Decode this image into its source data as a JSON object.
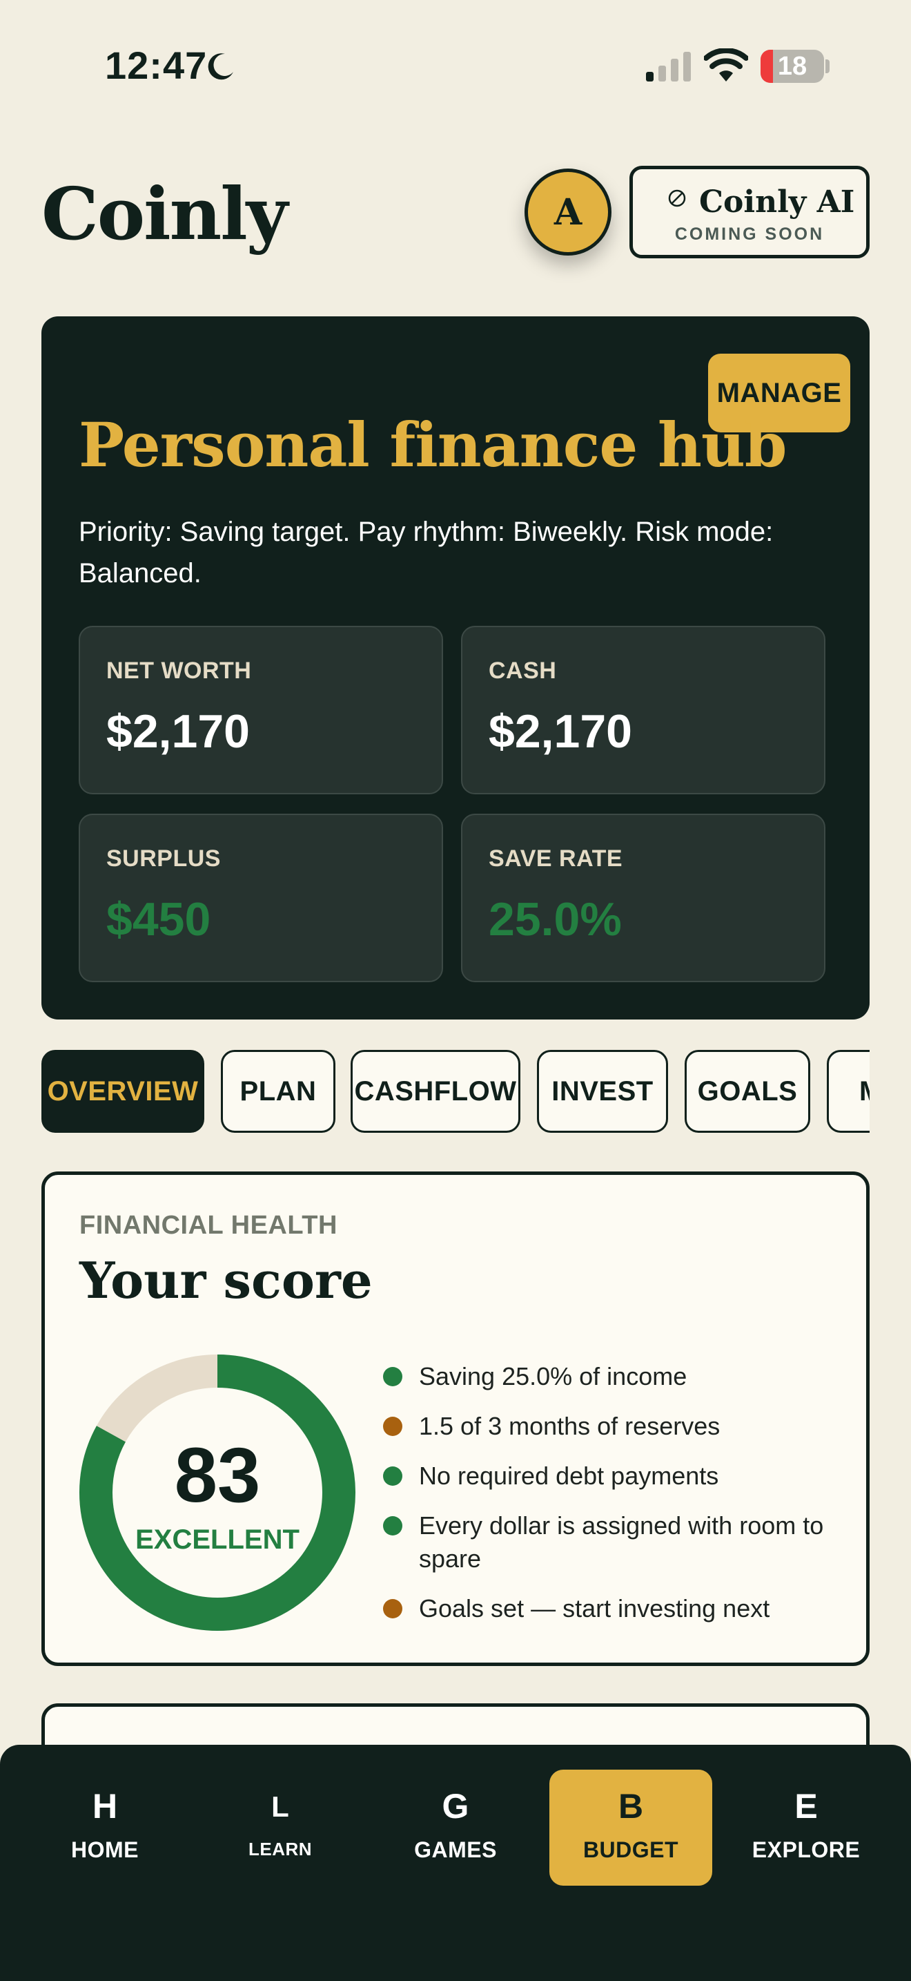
{
  "status_bar": {
    "time": "12:47",
    "battery": "18",
    "icons": [
      "moon-icon",
      "cellular-signal-icon",
      "wifi-icon",
      "battery-icon"
    ]
  },
  "header": {
    "brand": "Coinly",
    "avatar_initial": "A",
    "ai_button": {
      "title": "Coinly AI",
      "subtitle": "COMING SOON",
      "icon": "disabled-icon"
    }
  },
  "hub": {
    "manage_label": "MANAGE",
    "title": "Personal finance hub",
    "description": "Priority: Saving target. Pay rhythm: Biweekly. Risk mode: Balanced.",
    "metrics": [
      {
        "label": "NET WORTH",
        "value": "$2,170",
        "color": "#ffffff"
      },
      {
        "label": "CASH",
        "value": "$2,170",
        "color": "#ffffff"
      },
      {
        "label": "SURPLUS",
        "value": "$450",
        "color": "#237f41"
      },
      {
        "label": "SAVE RATE",
        "value": "25.0%",
        "color": "#237f41"
      }
    ]
  },
  "tabs": [
    {
      "label": "OVERVIEW",
      "active": true
    },
    {
      "label": "PLAN",
      "active": false
    },
    {
      "label": "CASHFLOW",
      "active": false
    },
    {
      "label": "INVEST",
      "active": false
    },
    {
      "label": "GOALS",
      "active": false
    },
    {
      "label": "M",
      "active": false
    }
  ],
  "score_card": {
    "eyebrow": "FINANCIAL HEALTH",
    "title": "Your score",
    "score": "83",
    "score_value": 83,
    "score_max": 100,
    "rating": "EXCELLENT",
    "factors": [
      {
        "text": "Saving 25.0% of income",
        "status": "good",
        "color": "#237f41"
      },
      {
        "text": "1.5 of 3 months of reserves",
        "status": "warning",
        "color": "#a8610f"
      },
      {
        "text": "No required debt payments",
        "status": "good",
        "color": "#237f41"
      },
      {
        "text": "Every dollar is assigned with room to spare",
        "status": "good",
        "color": "#237f41"
      },
      {
        "text": "Goals set — start investing next",
        "status": "warning",
        "color": "#a8610f"
      }
    ]
  },
  "bottom_nav": [
    {
      "glyph": "H",
      "label": "HOME",
      "active": false
    },
    {
      "glyph": "L",
      "label": "LEARN",
      "active": false
    },
    {
      "glyph": "G",
      "label": "GAMES",
      "active": false
    },
    {
      "glyph": "B",
      "label": "BUDGET",
      "active": true
    },
    {
      "glyph": "E",
      "label": "EXPLORE",
      "active": false
    }
  ],
  "colors": {
    "background": "#f2eee1",
    "dark": "#11201c",
    "accent": "#e2b241",
    "positive": "#237f41",
    "warning": "#a8610f",
    "track": "#e6dccb"
  }
}
